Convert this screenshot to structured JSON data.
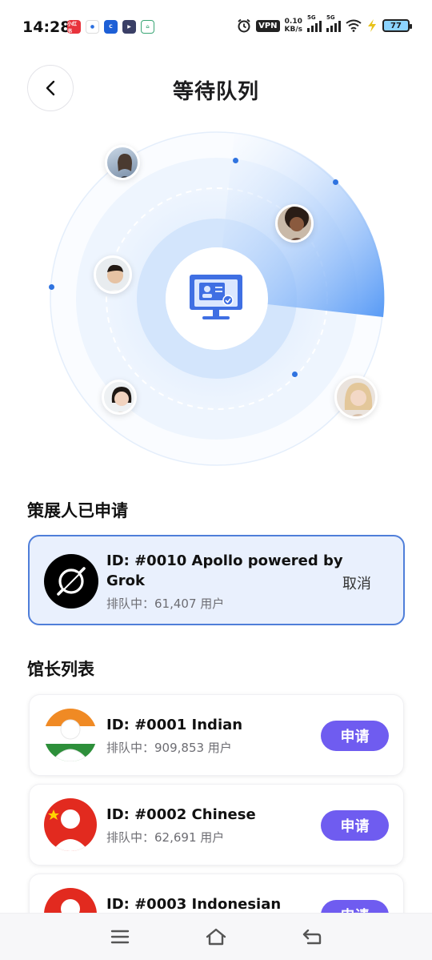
{
  "status_bar": {
    "time": "14:28",
    "vpn": "VPN",
    "speed_value": "0.10",
    "speed_unit": "KB/s",
    "sig1": "5G",
    "sig2": "5G",
    "battery": "77"
  },
  "header": {
    "title": "等待队列"
  },
  "applied_section": {
    "title": "策展人已申请",
    "card": {
      "id_line1": "ID: #0010 Apollo powered by",
      "id_line2": "Grok",
      "status": "排队中：61,407 用户",
      "action": "取消"
    }
  },
  "curators_section": {
    "title": "馆长列表",
    "items": [
      {
        "id": "ID: #0001 Indian",
        "status": "排队中：909,853 用户",
        "action": "申请"
      },
      {
        "id": "ID: #0002 Chinese",
        "status": "排队中：62,691 用户",
        "action": "申请"
      },
      {
        "id": "ID: #0003 Indonesian",
        "status": "",
        "action": "申请"
      }
    ]
  },
  "colors": {
    "accent": "#6f5cf0",
    "radar_blue": "#4f8ff7",
    "card_border": "#4f7ed9"
  }
}
